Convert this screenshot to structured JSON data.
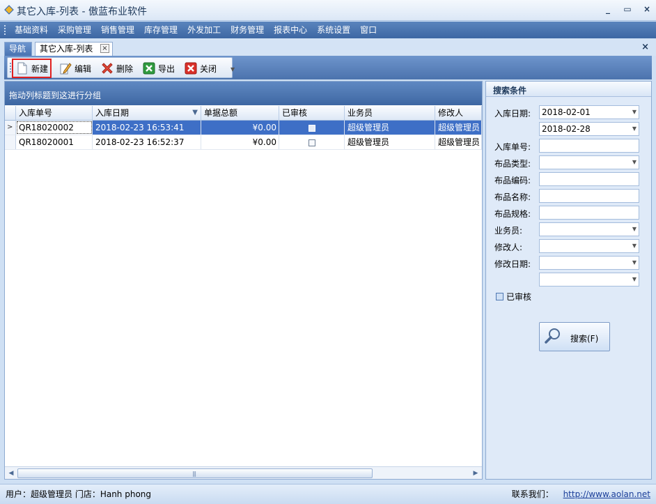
{
  "window": {
    "title": "其它入库-列表 - 傲蓝布业软件",
    "minimize": "_",
    "restore": "▭",
    "close": "×"
  },
  "menu": [
    "基础资料",
    "采购管理",
    "销售管理",
    "库存管理",
    "外发加工",
    "财务管理",
    "报表中心",
    "系统设置",
    "窗口"
  ],
  "tabs": {
    "nav": "导航",
    "doc": "其它入库-列表",
    "doc_close": "×",
    "close_all": "×"
  },
  "toolbar": {
    "new": "新建",
    "edit": "编辑",
    "delete": "删除",
    "export": "导出",
    "close": "关闭"
  },
  "grid": {
    "group_hint": "拖动列标题到这进行分组",
    "columns": [
      "入库单号",
      "入库日期",
      "单据总额",
      "已审核",
      "业务员",
      "修改人"
    ],
    "rows": [
      {
        "no": "QR18020002",
        "date": "2018-02-23 16:53:41",
        "amount": "¥0.00",
        "approved": false,
        "salesman": "超级管理员",
        "modifier": "超级管理员"
      },
      {
        "no": "QR18020001",
        "date": "2018-02-23 16:52:37",
        "amount": "¥0.00",
        "approved": false,
        "salesman": "超级管理员",
        "modifier": "超级管理员"
      }
    ]
  },
  "search": {
    "title": "搜索条件",
    "date_label": "入库日期:",
    "date_from": "2018-02-01",
    "date_to": "2018-02-28",
    "no_label": "入库单号:",
    "type_label": "布品类型:",
    "code_label": "布品编码:",
    "name_label": "布品名称:",
    "spec_label": "布品规格:",
    "salesman_label": "业务员:",
    "modifier_label": "修改人:",
    "mdate_label": "修改日期:",
    "approved_label": "已审核",
    "button": "搜索(F)"
  },
  "status": {
    "user": "用户：超级管理员  门店：Hanh phong",
    "contact_label": "联系我们：",
    "url": "http://www.aolan.net"
  },
  "colors": {
    "menubar": "#3d67a3",
    "selected_row": "#3e6fc6",
    "highlight_border": "#e02020"
  }
}
